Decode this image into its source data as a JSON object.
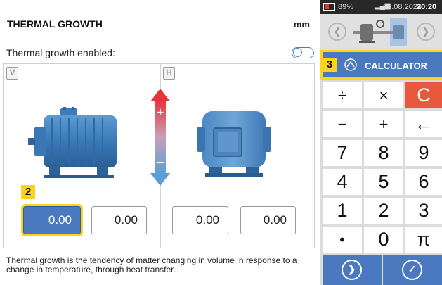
{
  "header": {
    "title": "THERMAL GROWTH",
    "unit": "mm"
  },
  "thermal_growth": {
    "label": "Thermal growth enabled:",
    "enabled": false
  },
  "views": {
    "vertical_label": "V",
    "horizontal_label": "H"
  },
  "badges": {
    "values": "2",
    "calculator": "3"
  },
  "values": {
    "v1": "0.00",
    "v2": "0.00",
    "h1": "0.00",
    "h2": "0.00"
  },
  "description": "Thermal growth is the tendency of matter changing in volume in response to a change in temperature, through heat transfer.",
  "status_bar": {
    "battery": "89%",
    "date": "06.08.2024",
    "time": "20:20"
  },
  "calculator": {
    "title": "CALCULATOR",
    "keys": [
      "÷",
      "×",
      "C",
      "−",
      "+",
      "←",
      "7",
      "8",
      "9",
      "4",
      "5",
      "6",
      "1",
      "2",
      "3",
      "•",
      "0",
      "π"
    ]
  },
  "colors": {
    "accent": "#4a79bf",
    "highlight": "#ffd21c",
    "clear": "#e8583d",
    "arrow_up": "#e8333a",
    "arrow_down": "#5b9fd8"
  }
}
